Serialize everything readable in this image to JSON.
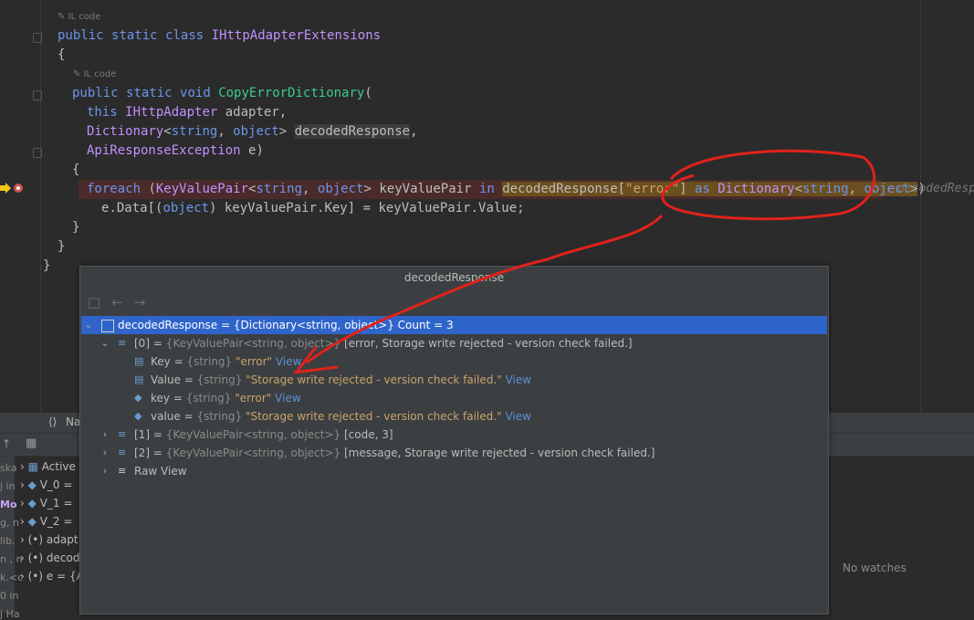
{
  "editor": {
    "il_label": "IL code",
    "class_decl": {
      "kw1": "public",
      "kw2": "static",
      "kw3": "class",
      "name": "IHttpAdapterExtensions"
    },
    "brace_open": "{",
    "brace_close": "}",
    "method_decl": {
      "kw1": "public",
      "kw2": "static",
      "kw3": "void",
      "name": "CopyErrorDictionary",
      "paren": "("
    },
    "param1": {
      "kw": "this",
      "type": "IHttpAdapter",
      "name": "adapter,"
    },
    "param2": {
      "type": "Dictionary",
      "lt": "<",
      "t1": "string",
      "comma": ", ",
      "t2": "object",
      "gt": ">",
      "name": "decodedResponse",
      "tail": ","
    },
    "param3": {
      "type": "ApiResponseException",
      "name": "e)"
    },
    "foreach": {
      "kw": "foreach",
      "open": " (",
      "kvp": "KeyValuePair",
      "lt": "<",
      "t1": "string",
      "c": ", ",
      "t2": "object",
      "gt": ">",
      "var": " keyValuePair ",
      "in": "in",
      "sp": " ",
      "expr": "decodedResponse[",
      "str": "\"error\"",
      "close": "]",
      "as": "as",
      "dict": "Dictionary",
      "lt2": "<",
      "t3": "string",
      "c2": ", ",
      "t4": "object",
      "gt2": ">",
      "end": ")"
    },
    "body_line": {
      "a": "e.Data[(",
      "kw": "object",
      "b": ") keyValuePair.Key] = keyValuePair.Value;"
    },
    "inlay": "decodedResp"
  },
  "popup": {
    "title": "decodedResponse",
    "nav_back": "←",
    "nav_fwd": "→",
    "rows": [
      {
        "name": "decodedResponse = ",
        "type": "{Dictionary<string, object>}",
        "tail": " Count = 3"
      },
      {
        "name": "[0] = ",
        "type": "{KeyValuePair<string, object>}",
        "tail": " [error, Storage write rejected - version check failed.]"
      },
      {
        "name": "Key = ",
        "type": "{string}",
        "val": " \"error\"",
        "link": "View"
      },
      {
        "name": "Value = ",
        "type": "{string}",
        "val": " \"Storage write rejected - version check failed.\"",
        "link": "View"
      },
      {
        "name": "key = ",
        "type": "{string}",
        "val": " \"error\"",
        "link": "View"
      },
      {
        "name": "value = ",
        "type": "{string}",
        "val": " \"Storage write rejected - version check failed.\"",
        "link": "View"
      },
      {
        "name": "[1] = ",
        "type": "{KeyValuePair<string, object>}",
        "tail": " [code, 3]"
      },
      {
        "name": "[2] = ",
        "type": "{KeyValuePair<string, object>}",
        "tail": " [message, Storage write rejected - version check failed.]"
      },
      {
        "name": "Raw View"
      }
    ]
  },
  "bottom": {
    "tab_label": "Na",
    "frames": [
      "ska",
      "j in",
      "Mo",
      "g, n",
      "lib.",
      "n , n",
      "k.<c",
      "0 in",
      "j Ha"
    ],
    "vars": [
      "Active",
      "V_0 =",
      "V_1 =",
      "V_2 =",
      "adapt",
      "decod",
      "e = {A"
    ],
    "no_watches": "No watches"
  },
  "colors": {
    "selection": "#2f65ca",
    "breakpoint_line": "#4a2a2a",
    "annotation": "#e0221c"
  }
}
